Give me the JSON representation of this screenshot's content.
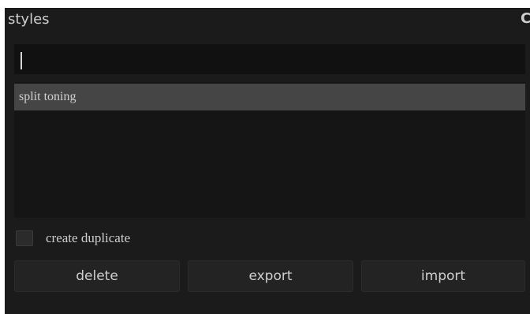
{
  "header": {
    "title": "styles",
    "reset_icon_glyph": "C"
  },
  "search": {
    "value": "",
    "placeholder": ""
  },
  "styles_list": {
    "items": [
      {
        "label": "split toning",
        "selected": true
      }
    ]
  },
  "options": {
    "create_duplicate": {
      "label": "create duplicate",
      "checked": false
    }
  },
  "buttons": {
    "delete": "delete",
    "export": "export",
    "import": "import"
  },
  "colors": {
    "panel_background": "#1b1b1b",
    "input_background": "#111111",
    "list_background": "#151515",
    "selected_item": "#454545",
    "button_background": "#232323",
    "text": "#cfcfcf"
  }
}
